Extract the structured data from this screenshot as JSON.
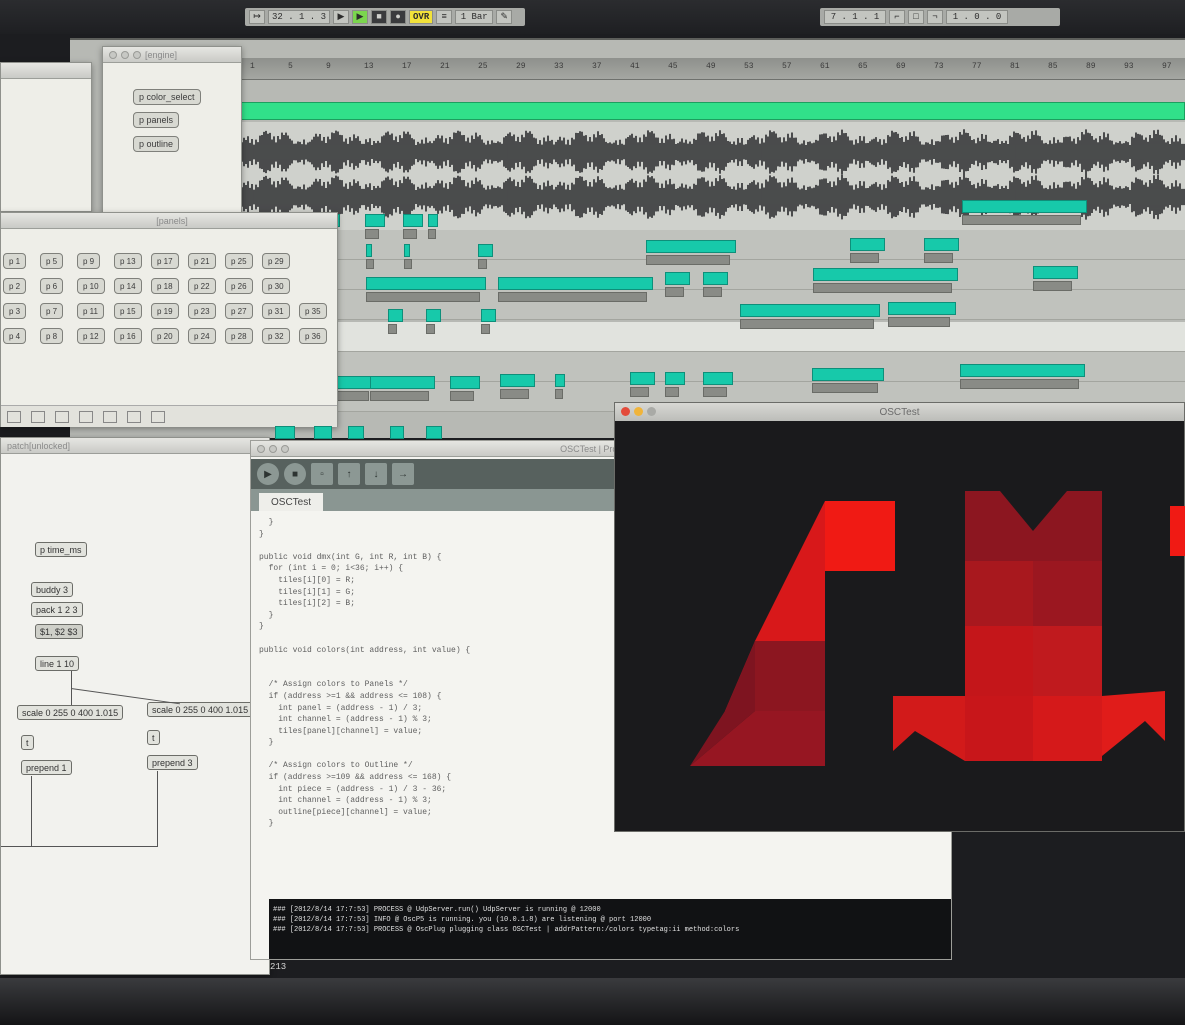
{
  "transport": {
    "position": "32 . 1 . 3",
    "ovr_label": "OVR",
    "bar_label": "1 Bar",
    "right_position": "7 . 1 . 1",
    "right_length": "1 . 0 . 0"
  },
  "daw": {
    "ruler_marks": [
      "1",
      "5",
      "9",
      "13",
      "17",
      "21",
      "25",
      "29",
      "33",
      "37",
      "41",
      "45",
      "49",
      "53",
      "57",
      "61",
      "65",
      "69",
      "73",
      "77",
      "81",
      "85",
      "89",
      "93",
      "97"
    ],
    "colors": {
      "clip": "#17c9aa",
      "scrubber": "#31e08a"
    }
  },
  "engine_window": {
    "title": "[engine]",
    "boxes": [
      "p color_select",
      "p panels",
      "p outline"
    ]
  },
  "panels_window": {
    "title": "[panels]",
    "grid": [
      [
        "p 1",
        "p 5",
        "p 9",
        "p 13",
        "p 17",
        "p 21",
        "p 25",
        "p 29"
      ],
      [
        "p 2",
        "p 6",
        "p 10",
        "p 14",
        "p 18",
        "p 22",
        "p 26",
        "p 30"
      ],
      [
        "p 3",
        "p 7",
        "p 11",
        "p 15",
        "p 19",
        "p 23",
        "p 27",
        "p 31",
        "p 35"
      ],
      [
        "p 4",
        "p 8",
        "p 12",
        "p 16",
        "p 20",
        "p 24",
        "p 28",
        "p 32",
        "p 36"
      ]
    ]
  },
  "patch_window": {
    "title": "patch[unlocked]",
    "objects": {
      "time_ms": "p time_ms",
      "buddy": "buddy 3",
      "pack": "pack 1 2 3",
      "msg": "$1, $2 $3",
      "line": "line 1 10",
      "scale1": "scale 0 255 0 400 1.015",
      "scale2": "scale 0 255 0 400 1.015",
      "t1": "t",
      "t2": "t",
      "prepend1": "prepend 1",
      "prepend2": "prepend 3"
    }
  },
  "pde": {
    "title": "OSCTest | Processing",
    "tab": "OSCTest",
    "code": [
      "  }",
      "}",
      "",
      "public void dmx(int G, int R, int B) {",
      "  for (int i = 0; i<36; i++) {",
      "    tiles[i][0] = R;",
      "    tiles[i][1] = G;",
      "    tiles[i][2] = B;",
      "  }",
      "}",
      "",
      "public void colors(int address, int value) {",
      "",
      "",
      "  /* Assign colors to Panels */",
      "  if (address >=1 && address <= 108) {",
      "    int panel = (address - 1) / 3;",
      "    int channel = (address - 1) % 3;",
      "    tiles[panel][channel] = value;",
      "  }",
      "",
      "  /* Assign colors to Outline */",
      "  if (address >=109 && address <= 168) {",
      "    int piece = (address - 1) / 3 - 36;",
      "    int channel = (address - 1) % 3;",
      "    outline[piece][channel] = value;",
      "  }"
    ],
    "console": [
      "### [2012/8/14 17:7:53] PROCESS @ UdpServer.run() UdpServer is running @ 12000",
      "### [2012/8/14 17:7:53] INFO @ OscP5 is running. you (10.0.1.8) are listening @ port 12000",
      "### [2012/8/14 17:7:53] PROCESS @ OscPlug plugging class OSCTest | addrPattern:/colors typetag:ii method:colors"
    ],
    "line_number": "213"
  },
  "osc_window": {
    "title": "OSCTest",
    "colors": {
      "bright": "#f01a14",
      "mid": "#c4161a",
      "dark": "#8c1620",
      "background": "#1a1a1c"
    }
  }
}
